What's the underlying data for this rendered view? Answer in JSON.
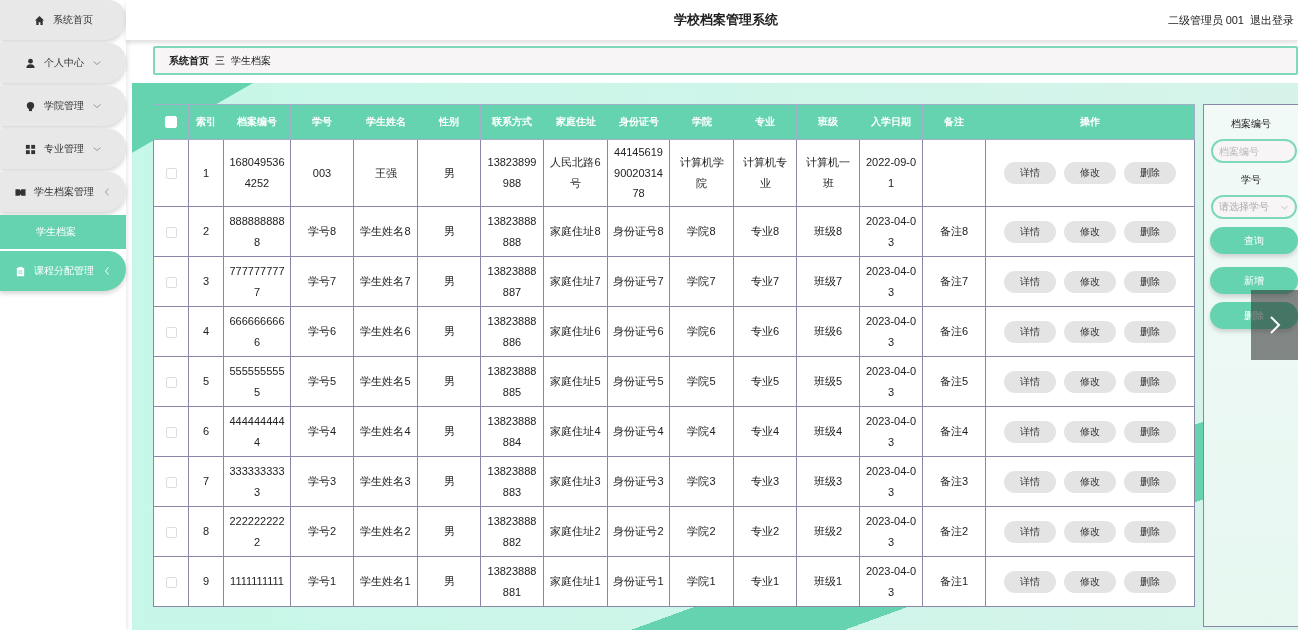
{
  "header": {
    "title": "学校档案管理系统",
    "user": "二级管理员 001",
    "logout": "退出登录"
  },
  "sidebar": {
    "items": [
      {
        "label": "系统首页",
        "expandable": false,
        "selected": false
      },
      {
        "label": "个人中心",
        "expandable": true,
        "expanded": false,
        "selected": false
      },
      {
        "label": "学院管理",
        "expandable": true,
        "expanded": false,
        "selected": false
      },
      {
        "label": "专业管理",
        "expandable": true,
        "expanded": false,
        "selected": false
      },
      {
        "label": "学生档案管理",
        "expandable": true,
        "expanded": true,
        "selected": false,
        "children": [
          {
            "label": "学生档案",
            "selected": true
          }
        ]
      },
      {
        "label": "课程分配管理",
        "expandable": true,
        "expanded": true,
        "selected": true
      }
    ]
  },
  "breadcrumb": {
    "items": [
      "系统首页",
      "学生档案"
    ],
    "separator": "三"
  },
  "table": {
    "header_checked": false,
    "columns": [
      "索引",
      "档案编号",
      "学号",
      "学生姓名",
      "性别",
      "联系方式",
      "家庭住址",
      "身份证号",
      "学院",
      "专业",
      "班级",
      "入学日期",
      "备注",
      "操作"
    ],
    "rows": [
      {
        "checked": false,
        "cells": [
          "1",
          "1680495364252",
          "003",
          "王强",
          "男",
          "13823899988",
          "人民北路6号",
          "441456199002031478",
          "计算机学院",
          "计算机专业",
          "计算机一班",
          "2022-09-01",
          ""
        ],
        "actions": [
          "详情",
          "修改",
          "删除"
        ]
      },
      {
        "checked": false,
        "cells": [
          "2",
          "8888888888",
          "学号8",
          "学生姓名8",
          "男",
          "13823888888",
          "家庭住址8",
          "身份证号8",
          "学院8",
          "专业8",
          "班级8",
          "2023-04-03",
          "备注8"
        ],
        "actions": [
          "详情",
          "修改",
          "删除"
        ]
      },
      {
        "checked": false,
        "cells": [
          "3",
          "7777777777",
          "学号7",
          "学生姓名7",
          "男",
          "13823888887",
          "家庭住址7",
          "身份证号7",
          "学院7",
          "专业7",
          "班级7",
          "2023-04-03",
          "备注7"
        ],
        "actions": [
          "详情",
          "修改",
          "删除"
        ]
      },
      {
        "checked": false,
        "cells": [
          "4",
          "6666666666",
          "学号6",
          "学生姓名6",
          "男",
          "13823888886",
          "家庭住址6",
          "身份证号6",
          "学院6",
          "专业6",
          "班级6",
          "2023-04-03",
          "备注6"
        ],
        "actions": [
          "详情",
          "修改",
          "删除"
        ]
      },
      {
        "checked": false,
        "cells": [
          "5",
          "5555555555",
          "学号5",
          "学生姓名5",
          "男",
          "13823888885",
          "家庭住址5",
          "身份证号5",
          "学院5",
          "专业5",
          "班级5",
          "2023-04-03",
          "备注5"
        ],
        "actions": [
          "详情",
          "修改",
          "删除"
        ]
      },
      {
        "checked": false,
        "cells": [
          "6",
          "4444444444",
          "学号4",
          "学生姓名4",
          "男",
          "13823888884",
          "家庭住址4",
          "身份证号4",
          "学院4",
          "专业4",
          "班级4",
          "2023-04-03",
          "备注4"
        ],
        "actions": [
          "详情",
          "修改",
          "删除"
        ]
      },
      {
        "checked": false,
        "cells": [
          "7",
          "3333333333",
          "学号3",
          "学生姓名3",
          "男",
          "13823888883",
          "家庭住址3",
          "身份证号3",
          "学院3",
          "专业3",
          "班级3",
          "2023-04-03",
          "备注3"
        ],
        "actions": [
          "详情",
          "修改",
          "删除"
        ]
      },
      {
        "checked": false,
        "cells": [
          "8",
          "2222222222",
          "学号2",
          "学生姓名2",
          "男",
          "13823888882",
          "家庭住址2",
          "身份证号2",
          "学院2",
          "专业2",
          "班级2",
          "2023-04-03",
          "备注2"
        ],
        "actions": [
          "详情",
          "修改",
          "删除"
        ]
      },
      {
        "checked": false,
        "cells": [
          "9",
          "1111111111",
          "学号1",
          "学生姓名1",
          "男",
          "13823888881",
          "家庭住址1",
          "身份证号1",
          "学院1",
          "专业1",
          "班级1",
          "2023-04-03",
          "备注1"
        ],
        "actions": [
          "详情",
          "修改",
          "删除"
        ]
      }
    ]
  },
  "search": {
    "fields": [
      {
        "kind": "input",
        "label": "档案编号",
        "placeholder": "档案编号"
      },
      {
        "kind": "select",
        "label": "学号",
        "placeholder": "请选择学号"
      }
    ],
    "buttons": [
      "查询",
      "新增",
      "删除"
    ]
  }
}
